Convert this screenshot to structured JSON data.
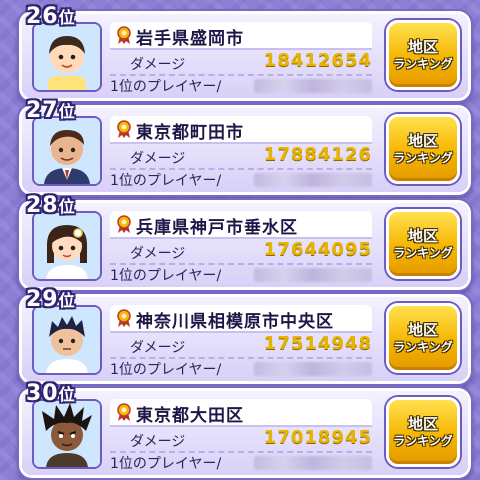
{
  "rank_suffix": "位",
  "damage_label": "ダメージ",
  "player_label": "1位のプレイヤー/",
  "region_button": {
    "line1": "地区",
    "line2": "ランキング"
  },
  "colors": {
    "accent_gold": "#e8b400",
    "card_border": "#7a68c4",
    "background": "#8e7fd6"
  },
  "entries": [
    {
      "rank": "26",
      "city": "岩手県盛岡市",
      "damage": "18412654",
      "avatar_icon": "boy-short-hair-avatar-icon"
    },
    {
      "rank": "27",
      "city": "東京都町田市",
      "damage": "17884126",
      "avatar_icon": "man-suit-avatar-icon"
    },
    {
      "rank": "28",
      "city": "兵庫県神戸市垂水区",
      "damage": "17644095",
      "avatar_icon": "woman-flower-hair-avatar-icon"
    },
    {
      "rank": "29",
      "city": "神奈川県相模原市中央区",
      "damage": "17514948",
      "avatar_icon": "boy-spiky-hair-avatar-icon"
    },
    {
      "rank": "30",
      "city": "東京都大田区",
      "damage": "17018945",
      "avatar_icon": "dark-spiky-hair-avatar-icon"
    }
  ]
}
